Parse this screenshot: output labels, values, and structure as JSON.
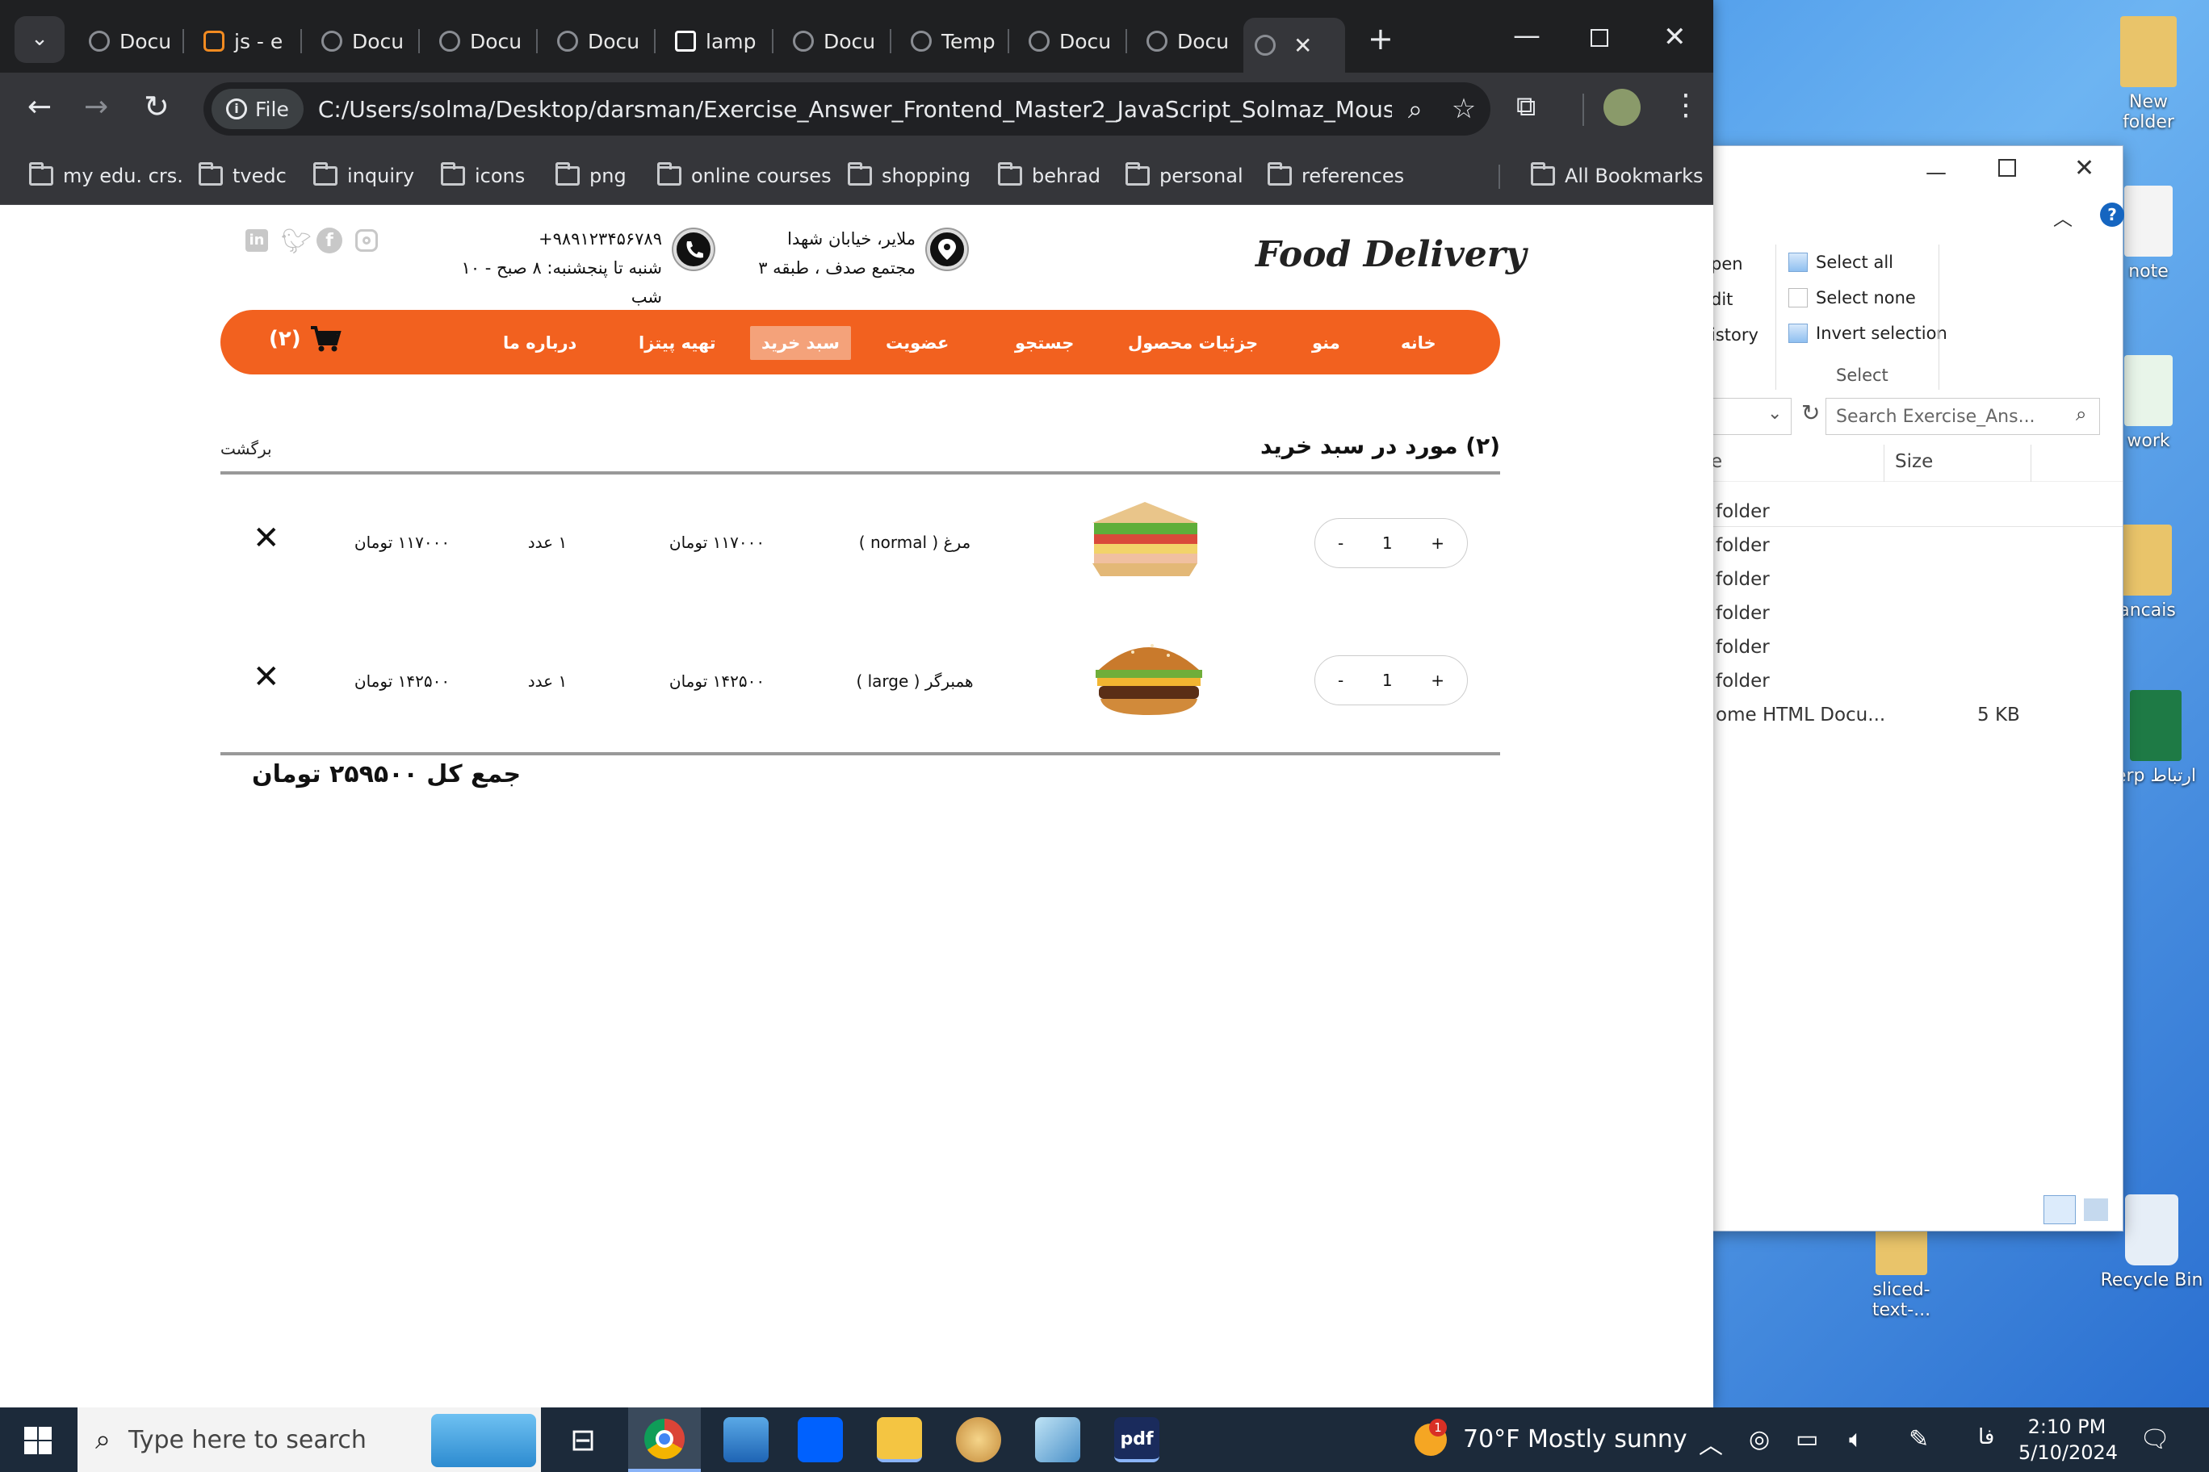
{
  "browser": {
    "tabs": [
      {
        "label": "Docu"
      },
      {
        "label": "js - e"
      },
      {
        "label": "Docu"
      },
      {
        "label": "Docu"
      },
      {
        "label": "Docu"
      },
      {
        "label": "lamp"
      },
      {
        "label": "Docu"
      },
      {
        "label": "Temp"
      },
      {
        "label": "Docu"
      },
      {
        "label": "Docu"
      }
    ],
    "new_tab": "+",
    "address_chip": "File",
    "url": "C:/Users/solma/Desktop/darsman/Exercise_Answer_Frontend_Master2_JavaScript_Solmaz_Mousavi_31_01...",
    "bookmarks": [
      "my edu. crs.",
      "tvedc",
      "inquiry",
      "icons",
      "png",
      "online courses",
      "shopping",
      "behrad",
      "personal",
      "references"
    ],
    "all_bookmarks": "All Bookmarks"
  },
  "site": {
    "logo": "Food Delivery",
    "address_line1": "ملایر، خیابان شهدا",
    "address_line2": "مجتمع صدف ، طبقه ۳",
    "phone": "+۹۸۹۱۲۳۴۵۶۷۸۹",
    "hours": "شنبه تا پنجشنبه: ۸ صبح - ۱۰ شب",
    "nav": [
      "خانه",
      "منو",
      "جزئیات محصول",
      "جستجو",
      "عضویت",
      "سبد خرید",
      "تهیه پیتزا",
      "درباره ما"
    ],
    "cart_badge": "(۲)",
    "cart_title": "(۲) مورد در سبد خرید",
    "back": "برگشت",
    "items": [
      {
        "name": "مرغ ( normal )",
        "unit_price": "۱۱۷۰۰۰ تومان",
        "qty_text": "۱ عدد",
        "total": "۱۱۷۰۰۰ تومان",
        "qty": "1",
        "image": "sandwich"
      },
      {
        "name": "همبرگر ( large )",
        "unit_price": "۱۴۲۵۰۰ تومان",
        "qty_text": "۱ عدد",
        "total": "۱۴۲۵۰۰ تومان",
        "qty": "1",
        "image": "burger"
      }
    ],
    "minus": "-",
    "plus": "+",
    "remove": "✕",
    "grand_total": "جمع کل ۲۵۹۵۰۰ تومان"
  },
  "explorer": {
    "ribbon_left": [
      "pen",
      "dit",
      "istory"
    ],
    "select_all": "Select all",
    "select_none": "Select none",
    "invert_selection": "Invert selection",
    "group_label": "Select",
    "search_placeholder": "Search Exercise_Ans...",
    "col_size": "Size",
    "rows": [
      "folder",
      "folder",
      "folder",
      "folder",
      "folder",
      "folder"
    ],
    "last_row_name": "ome HTML Docu...",
    "last_row_size": "5 KB"
  },
  "desktop_icons": [
    "New folder",
    "note",
    "work",
    "rancais",
    "erp ارتباط",
    "sliced-text-...",
    "Recycle Bin"
  ],
  "taskbar": {
    "search_placeholder": "Type here to search",
    "weather": "70°F  Mostly sunny",
    "weather_badge": "1",
    "lang": "فا",
    "time": "2:10 PM",
    "date": "5/10/2024"
  }
}
